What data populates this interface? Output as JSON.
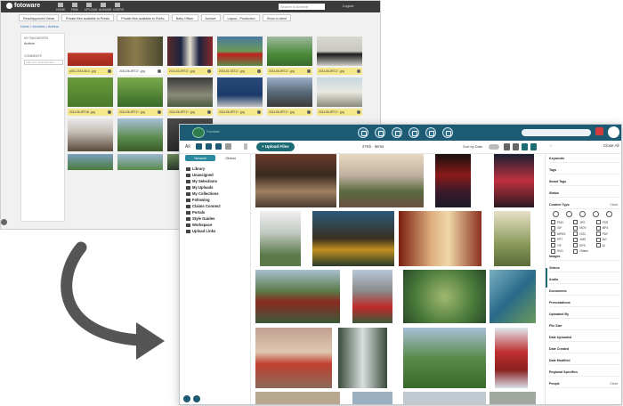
{
  "old_app": {
    "logo": "fotoware",
    "nav": [
      "HOME",
      "FIND",
      "UPLOAD",
      "ALBUMS",
      "USERS"
    ],
    "search_placeholder": "Search in Archive",
    "user": "Logout",
    "tabs": [
      "Read/approved Views",
      "Private files available to Presto",
      "Private files available to Public",
      "Baby Officer",
      "Archive",
      "Layout - Production",
      "Show to client"
    ],
    "breadcrumb": "Home  >  Archives  >  Archive",
    "side_label_1": "MY FAVOURITES",
    "side_selected": "Archive",
    "side_label_2": "COMMENTS",
    "side_input_placeholder": "Add your comment here...",
    "captions_row1": [
      "p001-2014-08-0...jpg",
      "2014-06-09T17...jpg",
      "2014-03-09T17...jpg",
      "2014-01-03T17...jpg",
      "2014-06-09T17...jpg",
      "2014-06-09T17...jpg"
    ],
    "captions_row2": [
      "2014-06-09T18...jpg",
      "2014-06-09T17...jpg",
      "2014-06-09T17...jpg",
      "2014-06-09T17...jpg",
      "2014-06-09T17...jpg",
      "2014-06-09T17...jpg"
    ]
  },
  "new_app": {
    "logo_text": "FotoWare",
    "upload_label": "+ Upload Files",
    "count_label": "27Kb · items",
    "sort_label": "Sort by Date",
    "close_all": "Close All",
    "side_tabs": [
      "Newest",
      "Oldest"
    ],
    "side_all": "All",
    "tree": [
      "Library",
      "Unassigned",
      "My Selections",
      "My Uploads",
      "My Collections",
      "Following",
      "Claims Connect",
      "Portals",
      "Style Guides",
      "Workspace",
      "Upload Links"
    ],
    "filters_top": [
      "Keywords",
      "Tags",
      "Smart Tags",
      "Status"
    ],
    "content_type_label": "Content Type",
    "content_type_clear": "Clear",
    "content_types": [
      "PNG",
      "JPG",
      "PSD",
      "GIF",
      "MOV",
      "MP4",
      "MPEG",
      "DOC",
      "PDF",
      "PPT",
      "XMS",
      "AVI",
      "TIF",
      "EPS",
      "AI",
      "SVG",
      "Others"
    ],
    "filters_bottom": [
      "Images",
      "Videos",
      "Audio",
      "Documents",
      "Presentations",
      "Uploaded By",
      "File Size",
      "Date Uploaded",
      "Date Created",
      "Date Modified",
      "Regional Specifics",
      "People"
    ],
    "people_clear": "Clear"
  },
  "colors": {
    "header": "#1d5a73",
    "accent": "#1d6b75",
    "segment_active": "#2b8a9e"
  }
}
